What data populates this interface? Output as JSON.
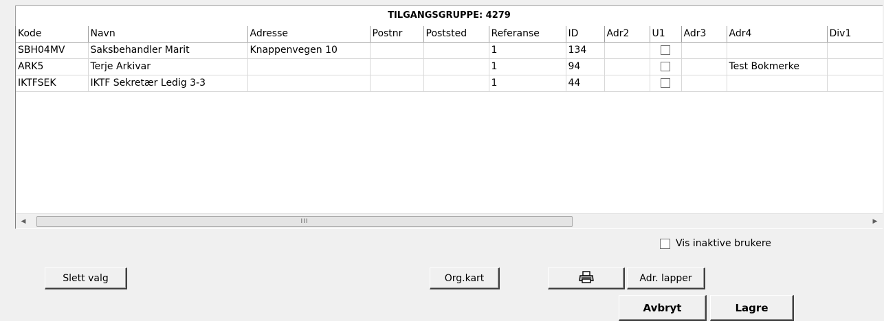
{
  "group_title": "TILGANGSGRUPPE: 4279",
  "table": {
    "columns": [
      "Kode",
      "Navn",
      "Adresse",
      "Postnr",
      "Poststed",
      "Referanse",
      "ID",
      "Adr2",
      "U1",
      "Adr3",
      "Adr4",
      "Div1"
    ],
    "rows": [
      {
        "kode": "SBH04MV",
        "navn": "Saksbehandler Marit",
        "adresse": "Knappenvegen 10",
        "postnr": "",
        "poststed": "",
        "referanse": "1",
        "id": "134",
        "adr2": "",
        "u1": false,
        "adr3": "",
        "adr4": "",
        "div1": ""
      },
      {
        "kode": "ARK5",
        "navn": "Terje Arkivar",
        "adresse": "",
        "postnr": "",
        "poststed": "",
        "referanse": "1",
        "id": "94",
        "adr2": "",
        "u1": false,
        "adr3": "",
        "adr4": "Test Bokmerke",
        "div1": ""
      },
      {
        "kode": "IKTFSEK",
        "navn": "IKTF Sekretær Ledig 3-3",
        "adresse": "",
        "postnr": "",
        "poststed": "",
        "referanse": "1",
        "id": "44",
        "adr2": "",
        "u1": false,
        "adr3": "",
        "adr4": "",
        "div1": ""
      }
    ]
  },
  "scrollbar": {
    "left_icon": "arrow-left-icon",
    "right_icon": "arrow-right-icon",
    "grip": "III"
  },
  "vis_inaktive": {
    "label": "Vis inaktive brukere",
    "checked": false
  },
  "buttons": {
    "slett_valg": "Slett valg",
    "org_kart": "Org.kart",
    "print_icon": "printer-icon",
    "adr_lapper": "Adr. lapper",
    "avbryt": "Avbryt",
    "lagre": "Lagre"
  }
}
